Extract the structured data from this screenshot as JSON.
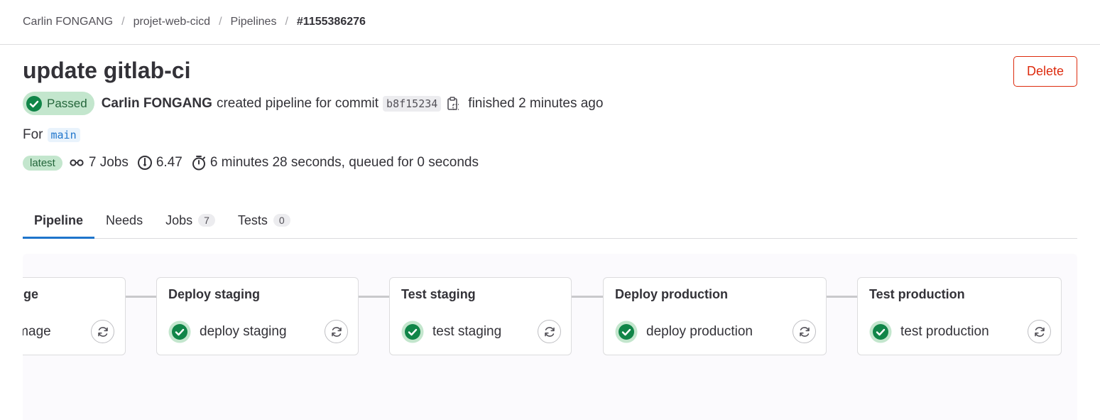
{
  "breadcrumb": {
    "items": [
      "Carlin FONGANG",
      "projet-web-cicd",
      "Pipelines"
    ],
    "current": "#1155386276",
    "separator": "/"
  },
  "header": {
    "title": "update gitlab-ci",
    "delete_label": "Delete"
  },
  "status": {
    "badge": "Passed",
    "author": "Carlin FONGANG",
    "action_text": "created pipeline for commit",
    "commit_sha": "b8f15234",
    "finished_text": "finished 2 minutes ago"
  },
  "ref": {
    "for_label": "For",
    "branch": "main"
  },
  "meta": {
    "latest_badge": "latest",
    "jobs_text": "7 Jobs",
    "score_text": "6.47",
    "duration_text": "6 minutes 28 seconds, queued for 0 seconds"
  },
  "tabs": [
    {
      "label": "Pipeline"
    },
    {
      "label": "Needs"
    },
    {
      "label": "Jobs",
      "count": "7"
    },
    {
      "label": "Tests",
      "count": "0"
    }
  ],
  "stages": [
    {
      "title": "ge",
      "job": "image"
    },
    {
      "title": "Deploy staging",
      "job": "deploy staging"
    },
    {
      "title": "Test staging",
      "job": "test staging"
    },
    {
      "title": "Deploy production",
      "job": "deploy production"
    },
    {
      "title": "Test production",
      "job": "test production"
    }
  ],
  "colors": {
    "success": "#108548",
    "danger": "#dd2b0e",
    "link": "#1f75cb"
  }
}
